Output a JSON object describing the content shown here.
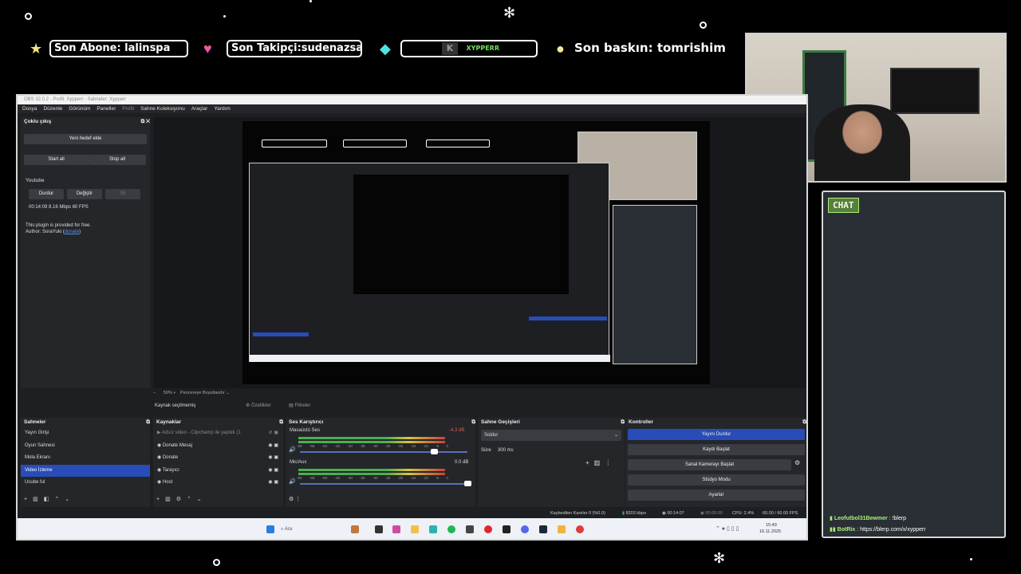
{
  "overlay": {
    "last_sub": "Son Abone: lalinspa",
    "last_follower": "Son Takipçi:sudenazsan",
    "brand": "XYPPERR",
    "last_raid": "Son baskın: tomrishim"
  },
  "obs": {
    "title": "OBS 32.0.2 - Profil: Xypperr - Sahneler: Xypperr",
    "menu": [
      "Dosya",
      "Düzenle",
      "Görünüm",
      "Paneller",
      "Sahne Koleksiyonu",
      "Araçlar",
      "Yardım"
    ],
    "profil": "Profil",
    "multi": {
      "title": "Çoklu çıkış",
      "add_target": "Yeni hedef ekle",
      "start_all": "Start all",
      "stop_all": "Stop all",
      "target_name": "Youtube",
      "stop": "Durdur",
      "change": "Değiştir",
      "delete": "Sil",
      "stats": "00:14:09  8.16 Mbps  60 FPS",
      "plugin_note": "This plugin is provided for free.",
      "author_prefix": "Author: SoraYuki (",
      "author_link": "donate",
      "author_suffix": ")"
    },
    "preview": {
      "zoom": "59%",
      "fit": "Pencereye Boyutlandır",
      "no_source": "Kaynak seçilmemiş",
      "props": "Özellikler",
      "filters": "Filtreler"
    },
    "scenes": {
      "title": "Sahneler",
      "items": [
        "Yayın Girişi",
        "Oyun Sahnesi",
        "Mola Ekranı",
        "Video İzleme",
        "Ucube ful"
      ],
      "selected_index": 3
    },
    "sources": {
      "title": "Kaynaklar",
      "items": [
        "Adsız video - Clipchamp ile yapıldı (1",
        "Donate Mesaj",
        "Donate",
        "Tarayıcı",
        "Host"
      ]
    },
    "mixer": {
      "title": "Ses Karıştırıcı",
      "tracks": [
        {
          "name": "Masaüstü Ses",
          "db": "-4.3 dB",
          "level": 0.62
        },
        {
          "name": "Mic/Aux",
          "db": "0.0 dB",
          "level": 0.85
        }
      ],
      "scale": [
        "-60",
        "-55",
        "-50",
        "-45",
        "-40",
        "-35",
        "-30",
        "-25",
        "-20",
        "-15",
        "-10",
        "-5",
        "0"
      ]
    },
    "transitions": {
      "title": "Sahne Geçişleri",
      "selected": "Soldur",
      "duration_label": "Süre",
      "duration": "300 ms"
    },
    "controls": {
      "title": "Kontroller",
      "buttons": [
        "Yayını Durdur",
        "Kaydı Başlat",
        "Sanal Kamerayı Başlat",
        "Stüdyo Modu",
        "Ayarlar"
      ]
    },
    "status": {
      "dropped": "Kaybedilen Kareler 0 (%0.0)",
      "bitrate": "8203 kbps",
      "live_time": "00:14:07",
      "rec_time": "00:00:00",
      "cpu": "CPU: 2.4%",
      "fps": "60.00 / 60.00 FPS"
    },
    "taskbar": {
      "search": "Ara",
      "time": "15:49",
      "date": "16.11.2025"
    }
  },
  "chat": {
    "badge": "CHAT",
    "messages": [
      {
        "user": "Leofutbol31Bewmer",
        "text": " : !blerp"
      },
      {
        "user": "BotRix",
        "text": " : https://blerp.com/x/xypperr"
      }
    ]
  },
  "colors": {
    "accent": "#284cb8",
    "chat_green": "#a9ef74",
    "bg": "#000000"
  }
}
